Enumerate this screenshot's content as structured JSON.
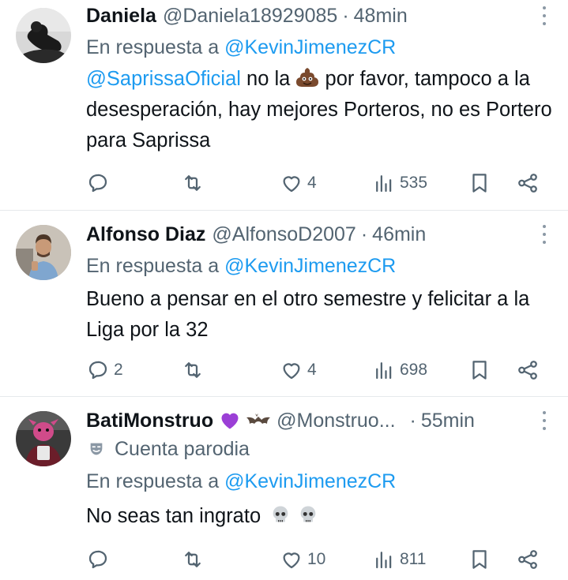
{
  "tweets": [
    {
      "name": "Daniela",
      "handle": "@Daniela18929085",
      "separator": "·",
      "time": "48min",
      "reply_prefix": "En respuesta a",
      "reply_to": "@KevinJimenezCR",
      "body_mention": "@SaprissaOficial",
      "body_part1": " no la ",
      "body_emoji": "poop-emoji",
      "body_part2": " por favor, tampoco a la desesperación, hay mejores Porteros, no es Portero para Saprissa",
      "replies": "",
      "retweets": "",
      "likes": "4",
      "views": "535"
    },
    {
      "name": "Alfonso Diaz",
      "handle": "@AlfonsoD2007",
      "separator": "·",
      "time": "46min",
      "reply_prefix": "En respuesta a",
      "reply_to": "@KevinJimenezCR",
      "body": "Bueno a pensar en el otro semestre y felicitar a la Liga por la 32",
      "replies": "2",
      "retweets": "",
      "likes": "4",
      "views": "698"
    },
    {
      "name": "BatiMonstruo",
      "name_emojis": [
        "purple-heart-emoji",
        "bat-emoji"
      ],
      "handle": "@Monstruo...",
      "separator": "·",
      "time": "55min",
      "parody_label": "Cuenta parodia",
      "reply_prefix": "En respuesta a",
      "reply_to": "@KevinJimenezCR",
      "body": "No seas tan ingrato",
      "body_emojis": [
        "skull-emoji",
        "skull-emoji"
      ],
      "replies": "",
      "retweets": "",
      "likes": "10",
      "views": "811"
    }
  ],
  "colors": {
    "text": "#0f1419",
    "secondary": "#536471",
    "link": "#1d9bf0",
    "divider": "#e6e9ec"
  }
}
